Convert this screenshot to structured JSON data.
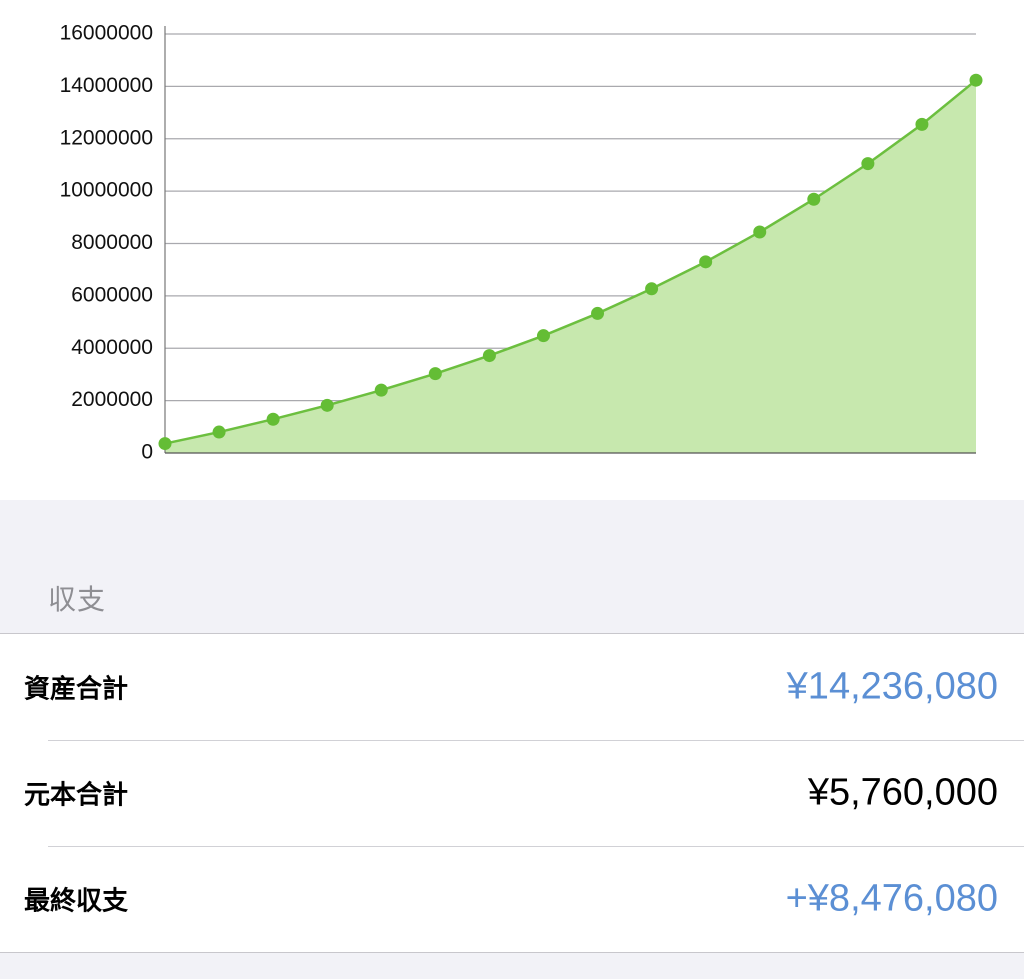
{
  "chart_data": {
    "type": "area",
    "x": [
      1,
      2,
      3,
      4,
      5,
      6,
      7,
      8,
      9,
      10,
      11,
      12,
      13,
      14,
      15,
      16
    ],
    "series": [
      {
        "values": [
          360000,
          800000,
          1290000,
          1820000,
          2400000,
          3030000,
          3720000,
          4480000,
          5330000,
          6270000,
          7300000,
          8440000,
          9690000,
          11050000,
          12550000,
          14236080
        ]
      }
    ],
    "ylim": [
      0,
      16000000
    ],
    "yticks": [
      0,
      2000000,
      4000000,
      6000000,
      8000000,
      10000000,
      12000000,
      14000000,
      16000000
    ],
    "ytick_labels": [
      "0",
      "2000000",
      "4000000",
      "6000000",
      "8000000",
      "10000000",
      "12000000",
      "14000000",
      "16000000"
    ],
    "grid": true,
    "title": "",
    "xlabel": "",
    "ylabel": "",
    "colors": {
      "line": "#6cbf3f",
      "fill": "#c7e8ae",
      "point": "#64bd35"
    }
  },
  "balance": {
    "section_title": "収支",
    "rows": [
      {
        "label": "資産合計",
        "value": "¥14,236,080",
        "color": "#5b8fd4"
      },
      {
        "label": "元本合計",
        "value": "¥5,760,000",
        "color": "#000000"
      },
      {
        "label": "最終収支",
        "value": "+¥8,476,080",
        "color": "#5b8fd4"
      }
    ]
  }
}
